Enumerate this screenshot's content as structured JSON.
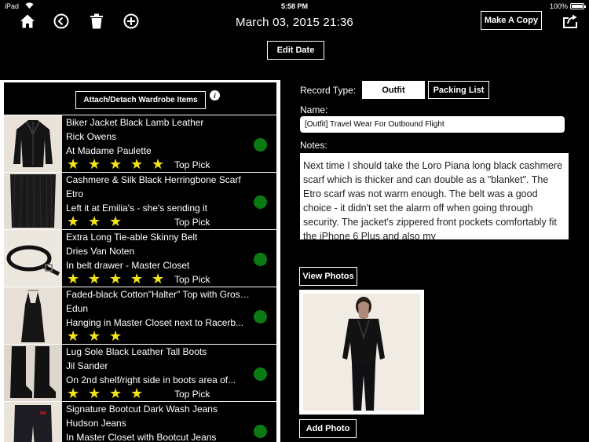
{
  "status_bar": {
    "carrier": "iPad",
    "time": "5:58 PM",
    "battery": "100%"
  },
  "header": {
    "title": "March 03, 2015 21:36",
    "make_copy_label": "Make A Copy",
    "edit_date_label": "Edit Date"
  },
  "wardrobe": {
    "attach_label": "Attach/Detach Wardrobe Items",
    "items": [
      {
        "name": "Biker Jacket Black Lamb Leather",
        "brand": "Rick Owens",
        "location": "At Madame Paulette",
        "stars": 5,
        "tag": "Top Pick"
      },
      {
        "name": "Cashmere & Silk Black Herringbone Scarf",
        "brand": "Etro",
        "location": "Left it at Emilia's - she's sending it",
        "stars": 3,
        "tag": "Top Pick"
      },
      {
        "name": "Extra Long Tie-able Skinny Belt",
        "brand": "Dries Van Noten",
        "location": "In belt drawer - Master Closet",
        "stars": 5,
        "tag": "Top Pick"
      },
      {
        "name": "Faded-black Cotton\"Halter\" Top with Grosgrai...",
        "brand": "Edun",
        "location": "Hanging in Master Closet next to Racerb...",
        "stars": 3,
        "tag": ""
      },
      {
        "name": "Lug Sole Black Leather Tall Boots",
        "brand": "Jil Sander",
        "location": "On 2nd shelf/right side in boots area of...",
        "stars": 4,
        "tag": "Top Pick"
      },
      {
        "name": "Signature Bootcut Dark Wash Jeans",
        "brand": "Hudson Jeans",
        "location": "In Master Closet with Bootcut Jeans",
        "stars": 0,
        "tag": ""
      }
    ]
  },
  "record": {
    "type_label": "Record Type:",
    "type_options": [
      "Outfit",
      "Packing List"
    ],
    "selected_type": "Outfit",
    "name_label": "Name:",
    "name_value": "[Outfit] Travel Wear For Outbound Flight",
    "notes_label": "Notes:",
    "notes_value": "Next time I should take the Loro Piana long black cashmere scarf which is thicker and can double as a \"blanket\".  The Etro scarf was not warm enough.  The belt was a good choice - it didn't set the alarm off when going through security.  The jacket's zippered front pockets comfortably fit the iPhone 6 Plus and also my",
    "view_photos_label": "View Photos",
    "add_photo_label": "Add Photo"
  },
  "colors": {
    "star": "#f2e51a",
    "status_dot": "#0c7a12",
    "background": "#000000"
  }
}
